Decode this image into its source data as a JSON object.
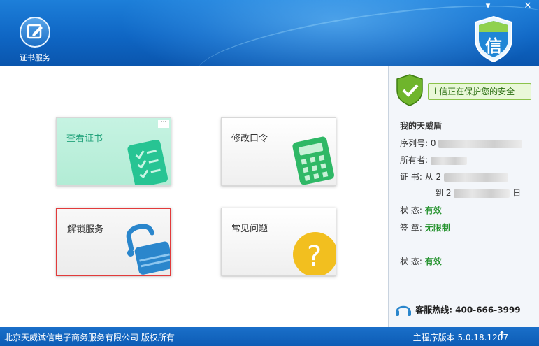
{
  "header": {
    "tab_label": "证书服务",
    "logo_char": "信",
    "controls": [
      "▾",
      "—",
      "✕"
    ]
  },
  "cards": {
    "view_cert": "查看证书",
    "change_pwd": "修改口令",
    "unlock": "解锁服务",
    "faq": "常见问题"
  },
  "side": {
    "status_text": "i 信正在保护您的安全",
    "section_title": "我的天威盾",
    "serial_label": "序列号:",
    "serial_value": "0",
    "owner_label": "所有者:",
    "cert_label": "证   书:",
    "cert_from": "从 2",
    "cert_to": "到 2",
    "cert_to_tail": "日",
    "state1_label": "状   态:",
    "state1_value": "有效",
    "seal_label": "签   章:",
    "seal_value": "无限制",
    "state2_label": "状   态:",
    "state2_value": "有效",
    "hotline": "客服热线: 400-666-3999"
  },
  "statusbar": {
    "copyright": "北京天威诚信电子商务服务有限公司 版权所有",
    "version": "主程序版本 5.0.18.1207",
    "update_icon": "↑"
  },
  "colors": {
    "header_blue": "#0f66c4",
    "accent_green": "#26932f",
    "unlock_border": "#e23b3b"
  }
}
